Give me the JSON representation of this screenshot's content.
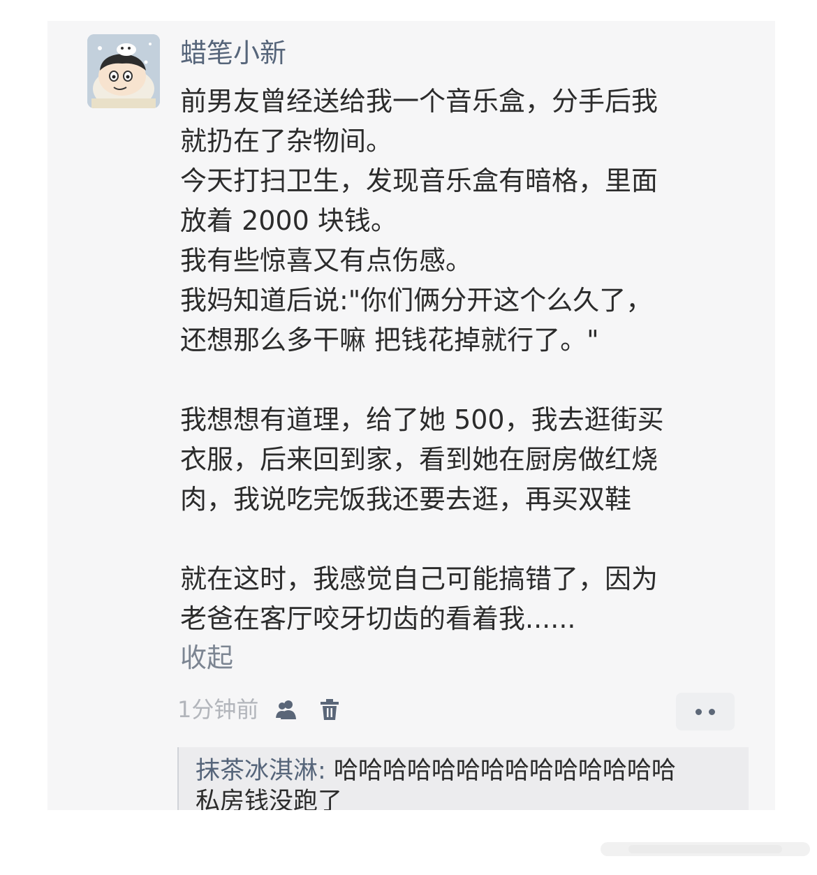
{
  "post": {
    "username": "蜡笔小新",
    "lines": [
      "前男友曾经送给我一个音乐盒，分手后我",
      "就扔在了杂物间。",
      "今天打扫卫生，发现音乐盒有暗格，里面",
      "放着 2000 块钱。",
      "我有些惊喜又有点伤感。",
      "我妈知道后说:\"你们俩分开这个么久了，",
      "还想那么多干嘛 把钱花掉就行了。\"",
      "",
      "我想想有道理，给了她 500，我去逛街买",
      "衣服，后来回到家，看到她在厨房做红烧",
      "肉，我说吃完饭我还要去逛，再买双鞋",
      "",
      "就在这时，我感觉自己可能搞错了，因为",
      "老爸在客厅咬牙切齿的看着我......"
    ],
    "collapse_label": "收起",
    "time": "1分钟前",
    "icons": {
      "visibility": "friends-icon",
      "delete": "trash-icon",
      "more": "more-icon"
    }
  },
  "comment": {
    "author": "抹茶冰淇淋:",
    "text_line1": " 哈哈哈哈哈哈哈哈哈哈哈哈哈哈",
    "text_line2": "私房钱没跑了"
  },
  "colors": {
    "card_bg": "#f6f6f7",
    "username": "#56657a",
    "body_text": "#2b2b2b",
    "muted": "#b2b5bb",
    "comment_bg": "#ececee"
  }
}
